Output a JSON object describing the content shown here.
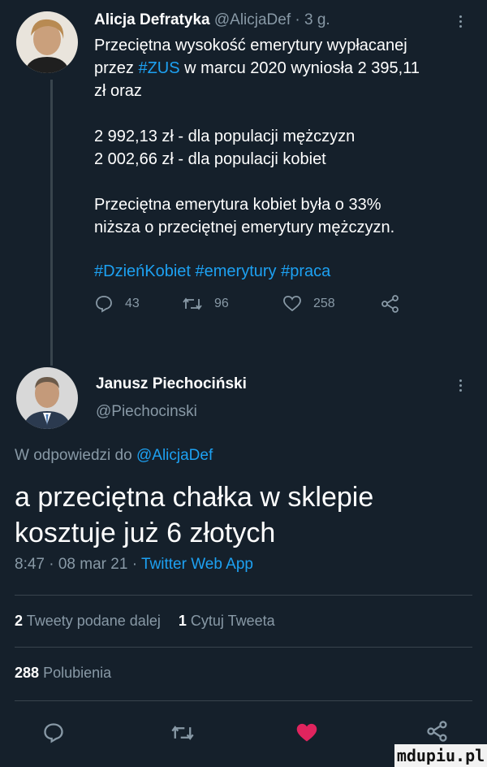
{
  "quoted": {
    "author_name": "Alicja Defratyka",
    "handle": "@AlicjaDef",
    "time": "· 3 g.",
    "lines": [
      "Przeciętna wysokość emerytury wypłacanej",
      "zł oraz",
      "2 992,13 zł - dla populacji mężczyzn",
      "2 002,66 zł - dla populacji kobiet",
      "Przeciętna emerytura kobiet była o 33%",
      "niższa o przeciętnej emerytury mężczyzn."
    ],
    "line2_prefix": "przez",
    "line2_hashtag": "#ZUS",
    "line2_suffix": "w marcu 2020 wyniosła 2 395,11",
    "hashtags": "#DzieńKobiet #emerytury #praca",
    "stats": {
      "replies": "43",
      "retweets": "96",
      "likes": "258"
    }
  },
  "main": {
    "author_name": "Janusz Piechociński",
    "handle": "@Piechocinski",
    "reply_prefix": "W odpowiedzi do",
    "reply_to": "@AlicjaDef",
    "text_line1": "a przeciętna chałka w sklepie",
    "text_line2": "kosztuje już 6 złotych",
    "meta_time": "8:47 · 08 mar 21 ·",
    "meta_source": "Twitter Web App",
    "retweets_count": "2",
    "retweets_label": "Tweety podane dalej",
    "quotes_count": "1",
    "quotes_label": "Cytuj Tweeta",
    "likes_count": "288",
    "likes_label": "Polubienia"
  },
  "watermark": "mdupiu.pl",
  "colors": {
    "background": "#15202b",
    "accent": "#1da1f2",
    "muted": "#8899a6",
    "like": "#e0245e"
  }
}
